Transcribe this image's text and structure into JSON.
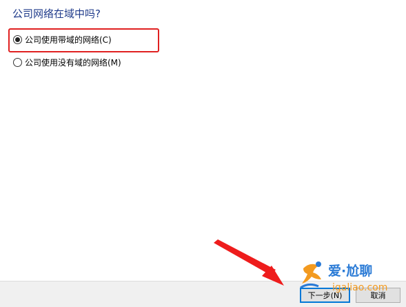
{
  "dialog": {
    "question": "公司网络在域中吗?",
    "options": [
      {
        "label": "公司使用带域的网络(C)",
        "selected": true
      },
      {
        "label": "公司使用没有域的网络(M)",
        "selected": false
      }
    ]
  },
  "buttons": {
    "next": "下一步(N)",
    "cancel": "取消"
  },
  "watermark": {
    "brand": "爱·尬聊",
    "domain": "igaliao.com"
  },
  "colors": {
    "highlight": "#e02020",
    "arrow": "#ee1c1c",
    "question_text": "#1e3a8a"
  }
}
